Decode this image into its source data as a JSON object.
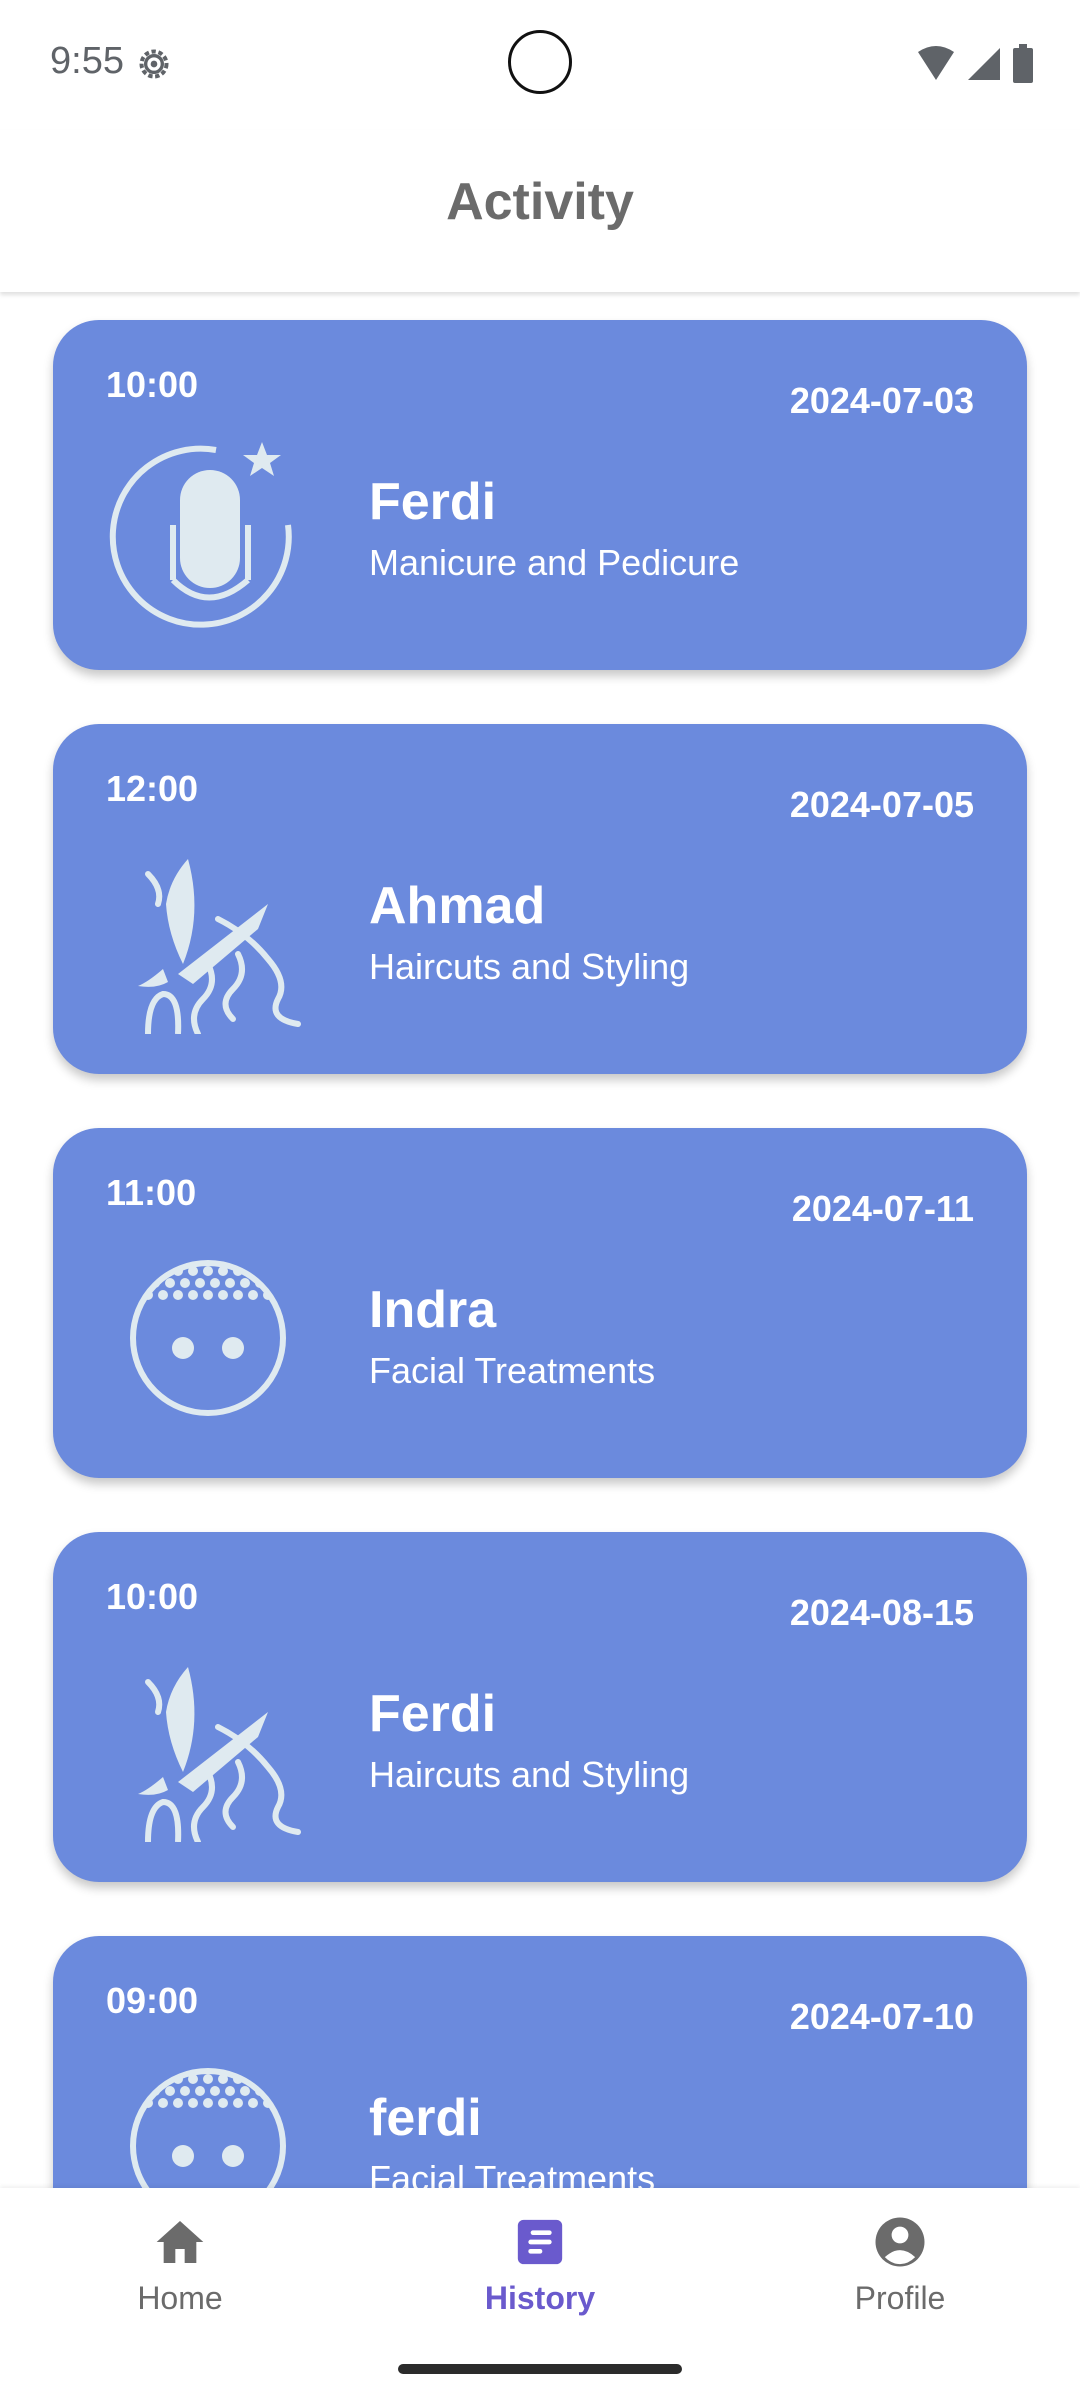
{
  "status_bar": {
    "time": "9:55",
    "icons": [
      "settings-gear-icon",
      "wifi-icon",
      "cellular-signal-icon",
      "battery-icon"
    ]
  },
  "header": {
    "title": "Activity"
  },
  "colors": {
    "card_background": "#6b8add",
    "card_text": "#ffffff",
    "icon_fill": "#dfeaf0",
    "nav_active": "#6a5acd",
    "nav_inactive": "#6b6b6b"
  },
  "appointments": [
    {
      "time": "10:00",
      "date": "2024-07-03",
      "name": "Ferdi",
      "service": "Manicure and Pedicure",
      "icon": "manicure-icon"
    },
    {
      "time": "12:00",
      "date": "2024-07-05",
      "name": "Ahmad",
      "service": "Haircuts and Styling",
      "icon": "haircut-scissors-icon"
    },
    {
      "time": "11:00",
      "date": "2024-07-11",
      "name": "Indra",
      "service": "Facial Treatments",
      "icon": "facial-treatment-icon"
    },
    {
      "time": "10:00",
      "date": "2024-08-15",
      "name": "Ferdi",
      "service": "Haircuts and Styling",
      "icon": "haircut-scissors-icon"
    },
    {
      "time": "09:00",
      "date": "2024-07-10",
      "name": "ferdi",
      "service": "Facial Treatments",
      "icon": "facial-treatment-icon"
    }
  ],
  "bottom_nav": {
    "items": [
      {
        "label": "Home",
        "icon": "home-icon",
        "active": false
      },
      {
        "label": "History",
        "icon": "history-icon",
        "active": true
      },
      {
        "label": "Profile",
        "icon": "profile-icon",
        "active": false
      }
    ]
  }
}
